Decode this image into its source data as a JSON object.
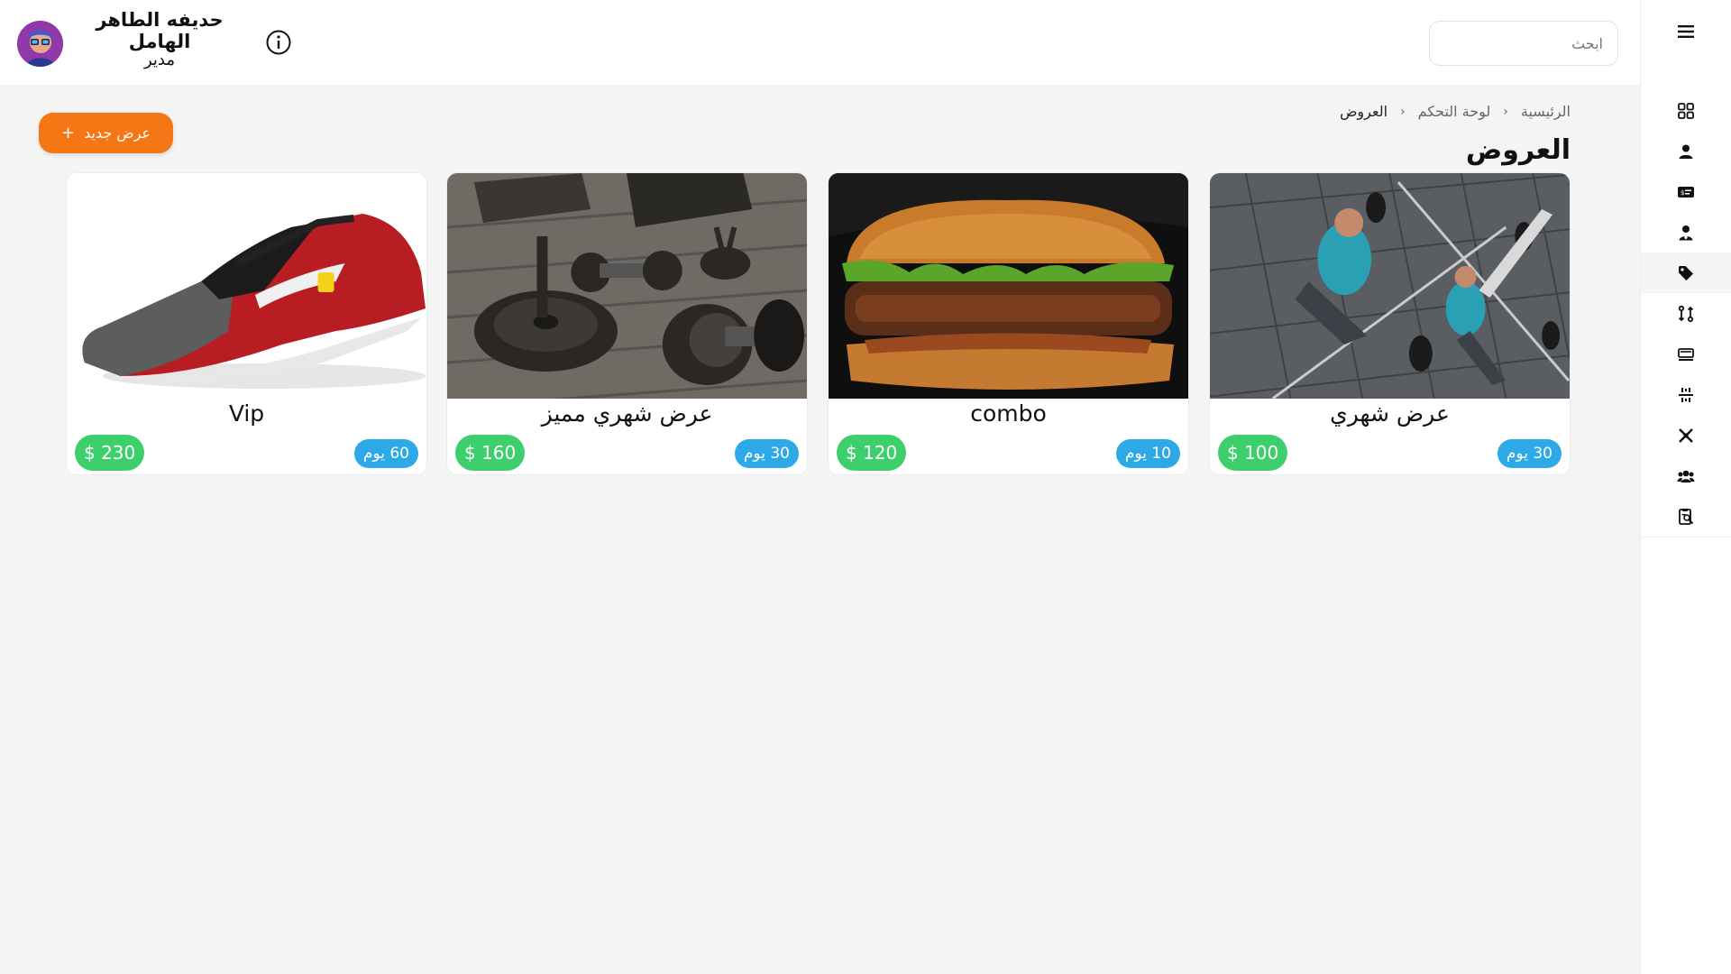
{
  "header": {
    "search_placeholder": "ابحث",
    "user_name": "حديفه الطاهر الهامل",
    "user_role": "مدير"
  },
  "sidebar": {
    "items": [
      {
        "icon": "grid-icon",
        "active": false
      },
      {
        "icon": "user-icon",
        "active": false
      },
      {
        "icon": "id-card-icon",
        "active": false
      },
      {
        "icon": "user-tie-icon",
        "active": false
      },
      {
        "icon": "tag-icon",
        "active": true
      },
      {
        "icon": "transfer-icon",
        "active": false
      },
      {
        "icon": "monitor-icon",
        "active": false
      },
      {
        "icon": "equalizer-icon",
        "active": false
      },
      {
        "icon": "dumbbell-icon",
        "active": false
      },
      {
        "icon": "users-icon",
        "active": false
      },
      {
        "icon": "report-icon",
        "active": false
      }
    ]
  },
  "breadcrumb": {
    "home": "الرئيسية",
    "dashboard": "لوحة التحكم",
    "current": "العروض"
  },
  "page": {
    "title": "العروض",
    "add_button": "عرض جديد",
    "add_button_icon": "+"
  },
  "offers": [
    {
      "title": "عرض شهري",
      "duration": "30 يوم",
      "price": "$ 100",
      "image": "gym-workout-photo"
    },
    {
      "title": "combo",
      "duration": "10 يوم",
      "price": "$ 120",
      "image": "burger-photo"
    },
    {
      "title": "عرض شهري مميز",
      "duration": "30 يوم",
      "price": "$ 160",
      "image": "dumbbells-photo"
    },
    {
      "title": "Vip",
      "duration": "60 يوم",
      "price": "$ 230",
      "image": "red-sneaker-photo"
    }
  ],
  "colors": {
    "accent": "#f57614",
    "price_badge": "#3ecf6d",
    "duration_badge": "#2ea9e8",
    "background": "#f4f4f3"
  }
}
